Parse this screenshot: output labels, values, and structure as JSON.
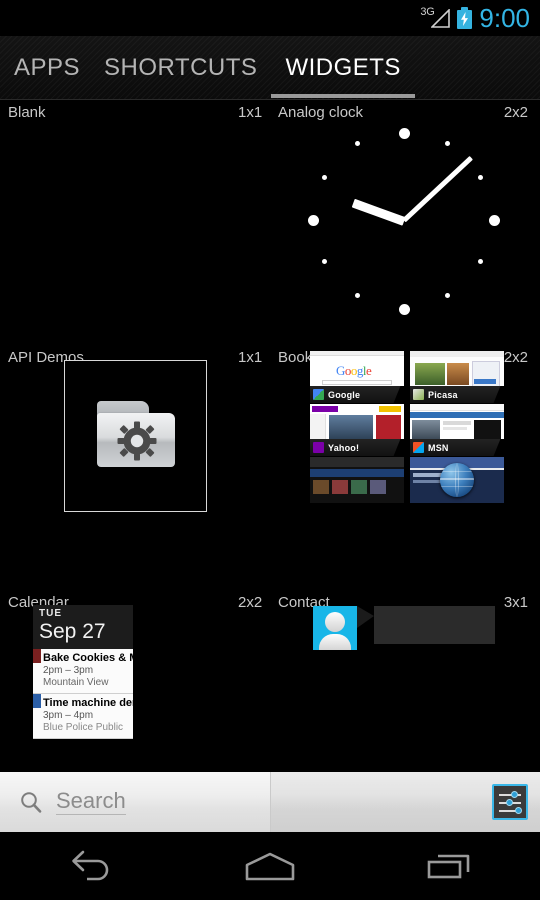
{
  "status_bar": {
    "network_label": "3G",
    "network_icon": "signal-triangle-icon",
    "battery_icon": "battery-charging-icon",
    "clock": "9:00",
    "clock_color": "#33b5e5",
    "battery_color": "#35b3e0"
  },
  "tabs": [
    {
      "label": "APPS",
      "active": false
    },
    {
      "label": "SHORTCUTS",
      "active": false
    },
    {
      "label": "WIDGETS",
      "active": true
    }
  ],
  "widgets": [
    {
      "name": "Blank",
      "size": "1x1",
      "preview": "blank-preview"
    },
    {
      "name": "Analog clock",
      "size": "2x2",
      "preview": "analog-clock-preview",
      "clock": {
        "hour_hand_angle": -125,
        "minute_hand_angle": -42,
        "large_dot_hours": [
          12,
          3,
          6,
          9
        ],
        "small_dot_hours": [
          1,
          2,
          4,
          5,
          7,
          8,
          10,
          11
        ]
      }
    },
    {
      "name": "API Demos",
      "size": "1x1",
      "preview": "folder-gear-icon"
    },
    {
      "name": "Bookmarks",
      "size": "2x2",
      "preview": "bookmarks-grid-preview",
      "bookmarks": [
        {
          "title": "Google",
          "favicon_color": "#4285f4"
        },
        {
          "title": "Picasa",
          "favicon_color": "#6aa84f"
        },
        {
          "title": "Yahoo!",
          "favicon_color": "#7b00a8"
        },
        {
          "title": "MSN",
          "favicon_color": "#1b7fd4"
        },
        {
          "title": "",
          "favicon_color": "#333333"
        },
        {
          "title": "",
          "favicon_color": "#3b5998"
        }
      ],
      "overlay_icon": "browser-globe-icon"
    },
    {
      "name": "Calendar",
      "size": "2x2",
      "preview": "calendar-preview",
      "calendar": {
        "day_of_week": "TUE",
        "date": "Sep 27",
        "events": [
          {
            "title": "Bake Cookies & Make Ice Cream",
            "time": "2pm – 3pm",
            "location": "Mountain View",
            "color": "#7a2020"
          },
          {
            "title": "Time machine demo for Sergey",
            "time": "3pm – 4pm",
            "location": "Blue Police Public",
            "color": "#2b5fa8"
          }
        ]
      }
    },
    {
      "name": "Contact",
      "size": "3x1",
      "preview": "contact-preview",
      "contact": {
        "avatar_icon": "person-avatar-icon",
        "avatar_color": "#18b6e8"
      }
    }
  ],
  "search": {
    "placeholder": "Search",
    "icon": "search-magnifier-icon",
    "settings_icon": "sliders-settings-icon",
    "settings_accent": "#3ab7e8"
  },
  "nav_bar": {
    "back_label": "Back",
    "home_label": "Home",
    "recents_label": "Recent apps",
    "back_icon": "back-arrow-icon",
    "home_icon": "home-icon",
    "recents_icon": "recent-apps-icon"
  }
}
